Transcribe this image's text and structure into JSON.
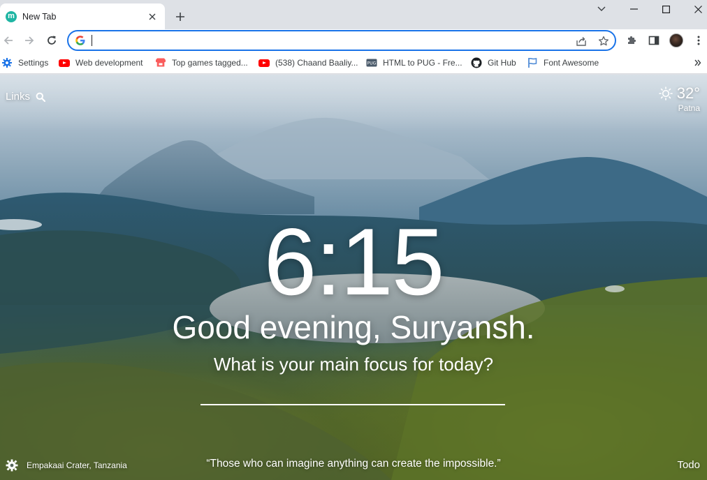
{
  "browser": {
    "tab": {
      "title": "New Tab",
      "favicon_letter": "m",
      "favicon_color": "#1fb5a3"
    },
    "address_bar": {
      "value": "",
      "placeholder": ""
    }
  },
  "bookmarks": [
    {
      "label": "Settings",
      "icon": "gear-icon"
    },
    {
      "label": "Web development",
      "icon": "youtube-icon"
    },
    {
      "label": "Top games tagged...",
      "icon": "itchio-icon"
    },
    {
      "label": "(538) Chaand Baaliy...",
      "icon": "youtube-icon"
    },
    {
      "label": "HTML to PUG - Fre...",
      "icon": "pug-icon"
    },
    {
      "label": "Git Hub",
      "icon": "github-icon"
    },
    {
      "label": "Font Awesome",
      "icon": "flag-icon"
    }
  ],
  "page": {
    "links_label": "Links",
    "weather": {
      "temperature": "32°",
      "city": "Patna",
      "icon": "sun-icon"
    },
    "clock": "6:15",
    "greeting": "Good evening, Suryansh.",
    "focus_question": "What is your main focus for today?",
    "focus_value": "",
    "photo_location": "Empakaai Crater, Tanzania",
    "quote": "“Those who can imagine anything can create the impossible.”",
    "todo_label": "Todo"
  },
  "colors": {
    "accent": "#1a73e8",
    "youtube_red": "#ff0000",
    "itch_red": "#fa5c5c",
    "fontawesome_blue": "#528dd7"
  }
}
